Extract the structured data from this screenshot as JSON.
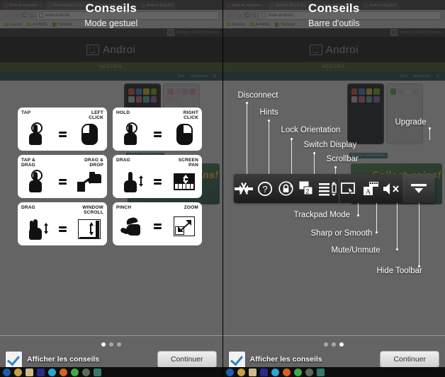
{
  "browser": {
    "tabs": [
      {
        "title": "Boîte de réception",
        "favicon": "gmail-icon",
        "active": false
      },
      {
        "title": "Android Blog & Ne...",
        "favicon": "android-icon",
        "active": true
      },
      {
        "title": "Android Blog & Ne...",
        "favicon": "android-icon",
        "active": false
      },
      {
        "title": "Android Blog & N",
        "favicon": "android-icon",
        "active": false
      }
    ],
    "nav": {
      "back": "←",
      "forward": "→",
      "reload": "C",
      "home": "⌂"
    },
    "url": "www.android...",
    "bookmarks": [
      "Favoris",
      "A FAIRE",
      "Terminé"
    ]
  },
  "site": {
    "greeting": "Bonjour, Quentin Ducreu",
    "logo_text": "Androi",
    "nav_item": "ACCUEIL",
    "subnav": [
      "Tout",
      "Hardware",
      "A"
    ],
    "news_tag": "NEWS / HARDWARE",
    "banner_text": "Collect coins!"
  },
  "left_panel": {
    "title": "Conseils",
    "subtitle": "Mode gestuel",
    "gestures": [
      {
        "left_label": "TAP",
        "right_label": "LEFT\nCLICK",
        "left_icon": "tap-hand-icon",
        "right_icon": "mouse-left-icon"
      },
      {
        "left_label": "HOLD",
        "right_label": "RIGHT\nCLICK",
        "left_icon": "hold-hand-icon",
        "right_icon": "mouse-right-icon"
      },
      {
        "left_label": "TAP &\nDRAG",
        "right_label": "DRAG  &\nDROP",
        "left_icon": "tap-drag-hand-icon",
        "right_icon": "drag-drop-icon"
      },
      {
        "left_label": "DRAG",
        "right_label": "SCREEN\nPAN",
        "left_icon": "drag-hand-icon",
        "right_icon": "screen-pan-icon"
      },
      {
        "left_label": "DRAG",
        "right_label": "WINDOW\nSCROLL",
        "left_icon": "two-finger-drag-icon",
        "right_icon": "window-scroll-icon"
      },
      {
        "left_label": "PINCH",
        "right_label": "ZOOM",
        "left_icon": "pinch-hand-icon",
        "right_icon": "zoom-box-icon"
      }
    ],
    "equals_symbol": "=",
    "dots": {
      "count": 3,
      "active_index": 0
    },
    "checkbox_label": "Afficher les conseils",
    "checkbox_checked": true,
    "continue_label": "Continuer"
  },
  "right_panel": {
    "title": "Conseils",
    "subtitle": "Barre d'outils",
    "callouts_top": [
      "Disconnect",
      "Hints",
      "Lock Orientation",
      "Switch Display",
      "Scrollbar"
    ],
    "callouts_bottom": [
      "Trackpad Mode",
      "Sharp or Smooth",
      "Mute/Unmute",
      "Hide Toolbar"
    ],
    "callout_upgrade": "Upgrade",
    "toolbar_buttons": [
      {
        "name": "disconnect-icon",
        "label": "Disconnect"
      },
      {
        "name": "hints-icon",
        "label": "Hints"
      },
      {
        "name": "lock-orientation-icon",
        "label": "Lock Orientation"
      },
      {
        "name": "switch-display-icon",
        "label": "Switch Display"
      },
      {
        "name": "scrollbar-icon",
        "label": "Scrollbar"
      },
      {
        "name": "trackpad-mode-icon",
        "label": "Trackpad Mode"
      },
      {
        "name": "sharp-or-smooth-icon",
        "label": "Sharp or Smooth"
      },
      {
        "name": "mute-unmute-icon",
        "label": "Mute/Unmute"
      },
      {
        "name": "hide-toolbar-icon",
        "label": "Hide Toolbar"
      }
    ],
    "dots": {
      "count": 3,
      "active_index": 2
    },
    "checkbox_label": "Afficher les conseils",
    "checkbox_checked": true,
    "continue_label": "Continuer"
  },
  "colors": {
    "overlay": "#2b2b2bb8",
    "accent_check": "#2a7fd4",
    "site_nav_green": "#41561f",
    "site_subnav_blue": "#1f3d4f",
    "toolbar_dark": "#1b1b1b"
  }
}
